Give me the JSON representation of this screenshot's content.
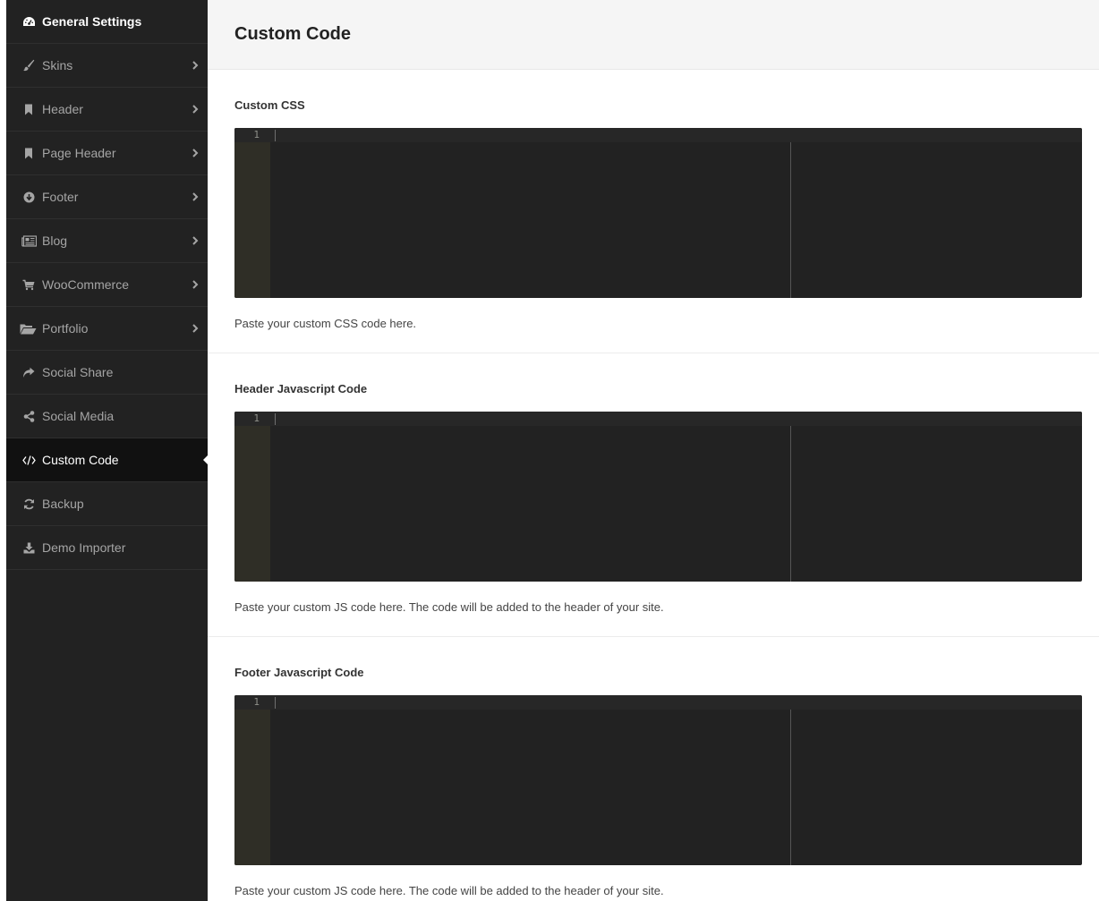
{
  "sidebar": {
    "items": [
      {
        "label": "General Settings",
        "icon": "dashboard-icon",
        "has_submenu": false,
        "active": false
      },
      {
        "label": "Skins",
        "icon": "paintbrush-icon",
        "has_submenu": true,
        "active": false
      },
      {
        "label": "Header",
        "icon": "bookmark-icon",
        "has_submenu": true,
        "active": false
      },
      {
        "label": "Page Header",
        "icon": "bookmark-icon",
        "has_submenu": true,
        "active": false
      },
      {
        "label": "Footer",
        "icon": "arrow-circle-down-icon",
        "has_submenu": true,
        "active": false
      },
      {
        "label": "Blog",
        "icon": "newspaper-icon",
        "has_submenu": true,
        "active": false
      },
      {
        "label": "WooCommerce",
        "icon": "shopping-cart-icon",
        "has_submenu": true,
        "active": false
      },
      {
        "label": "Portfolio",
        "icon": "folder-open-icon",
        "has_submenu": true,
        "active": false
      },
      {
        "label": "Social Share",
        "icon": "share-icon",
        "has_submenu": false,
        "active": false
      },
      {
        "label": "Social Media",
        "icon": "share-alt-icon",
        "has_submenu": false,
        "active": false
      },
      {
        "label": "Custom Code",
        "icon": "code-icon",
        "has_submenu": false,
        "active": true
      },
      {
        "label": "Backup",
        "icon": "refresh-icon",
        "has_submenu": false,
        "active": false
      },
      {
        "label": "Demo Importer",
        "icon": "download-icon",
        "has_submenu": false,
        "active": false
      }
    ]
  },
  "main": {
    "title": "Custom Code",
    "sections": [
      {
        "title": "Custom CSS",
        "line_number": "1",
        "help": "Paste your custom CSS code here."
      },
      {
        "title": "Header Javascript Code",
        "line_number": "1",
        "help": "Paste your custom JS code here. The code will be added to the header of your site."
      },
      {
        "title": "Footer Javascript Code",
        "line_number": "1",
        "help": "Paste your custom JS code here. The code will be added to the header of your site."
      }
    ]
  },
  "colors": {
    "sidebar_bg": "#222222",
    "sidebar_active_bg": "#111111",
    "editor_bg": "#222222",
    "editor_gutter": "#2f2e26"
  }
}
